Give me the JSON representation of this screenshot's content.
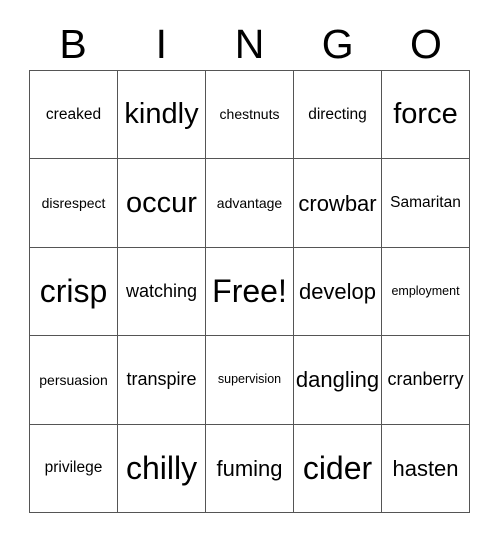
{
  "card": {
    "title": "BINGO",
    "header_letters": [
      "B",
      "I",
      "N",
      "G",
      "O"
    ],
    "free_space_label": "Free!",
    "colors": {
      "text": "#000000",
      "grid_line": "#555555",
      "background": "#ffffff"
    },
    "rows": [
      [
        {
          "text": "creaked",
          "size": "fs-m"
        },
        {
          "text": "kindly",
          "size": "fs-xxl"
        },
        {
          "text": "chestnuts",
          "size": "fs-s"
        },
        {
          "text": "directing",
          "size": "fs-m"
        },
        {
          "text": "force",
          "size": "fs-xxl"
        }
      ],
      [
        {
          "text": "disrespect",
          "size": "fs-s"
        },
        {
          "text": "occur",
          "size": "fs-xxl"
        },
        {
          "text": "advantage",
          "size": "fs-s"
        },
        {
          "text": "crowbar",
          "size": "fs-xl"
        },
        {
          "text": "Samaritan",
          "size": "fs-m"
        }
      ],
      [
        {
          "text": "crisp",
          "size": "fs-huge"
        },
        {
          "text": "watching",
          "size": "fs-l"
        },
        {
          "text": "Free!",
          "size": "fs-huge"
        },
        {
          "text": "develop",
          "size": "fs-xl"
        },
        {
          "text": "employment",
          "size": "fs-xs"
        }
      ],
      [
        {
          "text": "persuasion",
          "size": "fs-s"
        },
        {
          "text": "transpire",
          "size": "fs-l"
        },
        {
          "text": "supervision",
          "size": "fs-xs"
        },
        {
          "text": "dangling",
          "size": "fs-xl"
        },
        {
          "text": "cranberry",
          "size": "fs-l"
        }
      ],
      [
        {
          "text": "privilege",
          "size": "fs-m"
        },
        {
          "text": "chilly",
          "size": "fs-huge"
        },
        {
          "text": "fuming",
          "size": "fs-xl"
        },
        {
          "text": "cider",
          "size": "fs-huge"
        },
        {
          "text": "hasten",
          "size": "fs-xl"
        }
      ]
    ]
  }
}
